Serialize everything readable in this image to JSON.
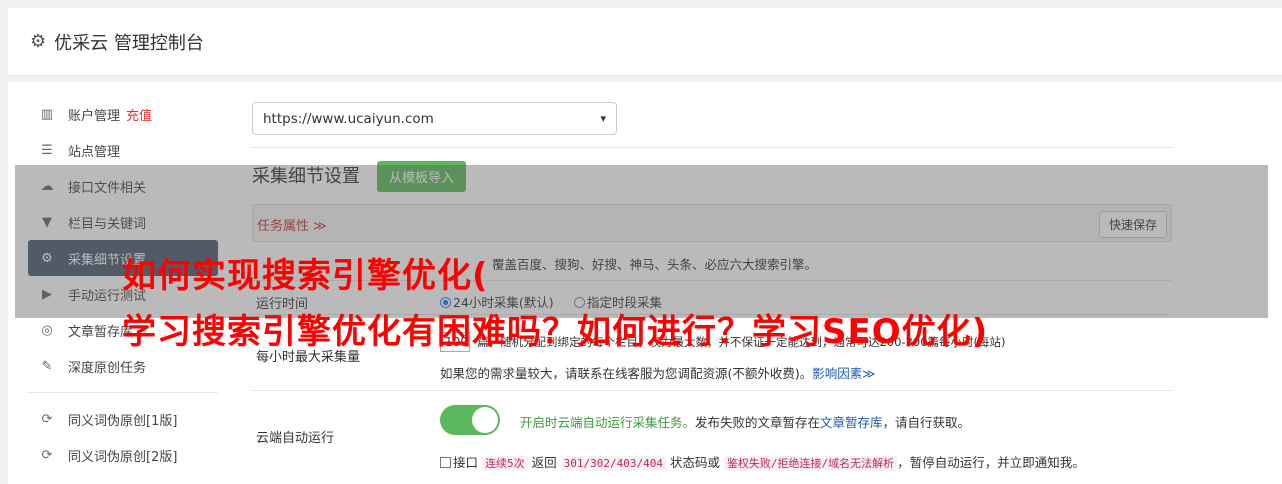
{
  "header": {
    "icon": "gear-icon",
    "title": "优采云 管理控制台"
  },
  "sidebar": {
    "items": [
      {
        "icon": "bar-chart-icon",
        "label": "账户管理",
        "extra": "充值"
      },
      {
        "icon": "server-icon",
        "label": "站点管理"
      },
      {
        "icon": "cloud-upload-icon",
        "label": "接口文件相关"
      },
      {
        "icon": "filter-icon",
        "label": "栏目与关键词"
      },
      {
        "icon": "cogs-icon",
        "label": "采集细节设置"
      },
      {
        "icon": "play-circle-icon",
        "label": "手动运行测试"
      },
      {
        "icon": "database-icon",
        "label": "文章暂存库"
      },
      {
        "icon": "edit-icon",
        "label": "深度原创任务"
      },
      {
        "icon": "refresh-icon",
        "label": "同义词伪原创[1版]"
      },
      {
        "icon": "refresh-icon",
        "label": "同义词伪原创[2版]"
      }
    ]
  },
  "main": {
    "site_select": "https://www.ucaiyun.com",
    "section_title": "采集细节设置",
    "import_button": "从模板导入",
    "task_label": "任务属性 ≫",
    "quick_save": "快速保存",
    "engines_text": "覆盖百度、搜狗、好搜、神马、头条、必应六大搜索引擎。",
    "run_time_label": "运行时间",
    "radio_24h": "24小时采集(默认)",
    "radio_custom": "指定时段采集",
    "max_label": "每小时最大采集量",
    "max_value": "100",
    "max_desc": "篇，随机分配到绑定的每个栏目，仅为最大数，并不保证一定能达到，通常可达200-300篇每小时(每站)",
    "contact_text": "如果您的需求量较大，请联系在线客服为您调配资源(不额外收费)。",
    "factor_link": "影响因素≫",
    "cloud_label": "云端自动运行",
    "cloud_green": "开启时云端自动运行采集任务。",
    "cloud_text1": "发布失败的文章暂存在",
    "cloud_link": "文章暂存库",
    "cloud_text2": "，请自行获取。",
    "iface_a": "接口",
    "iface_code1": "连续5次",
    "iface_b": "返回",
    "iface_code2": "301/302/403/404",
    "iface_c": "状态码或",
    "iface_code3": "鉴权失败/拒绝连接/域名无法解析",
    "iface_d": "，暂停自动运行，并立即通知我。"
  },
  "watermark": {
    "line1": "如何实现搜索引擎优化(",
    "line2": "学习搜索引擎优化有困难吗？如何进行？学习SEO优化)"
  },
  "colors": {
    "accent_green": "#5cb85c",
    "active_nav": "#4a5b70",
    "warning_red": "#e32",
    "watermark": "#ff0000"
  }
}
